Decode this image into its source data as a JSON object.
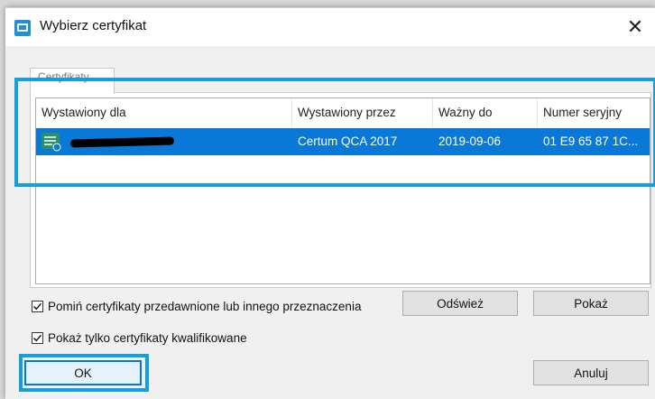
{
  "window": {
    "title": "Wybierz certyfikat",
    "close_label": "✕"
  },
  "tabs": [
    {
      "label": "Certyfikaty"
    }
  ],
  "table": {
    "columns": [
      "Wystawiony dla",
      "Wystawiony przez",
      "Ważny do",
      "Numer seryjny"
    ],
    "rows": [
      {
        "issued_to": "",
        "issued_by": "Certum QCA 2017",
        "valid_to": "2019-09-06",
        "serial": "01 E9 65 87 1C...",
        "selected": true
      }
    ]
  },
  "options": {
    "skip_expired_label": "Pomiń certyfikaty przedawnione lub innego przeznaczenia",
    "skip_expired_checked": true,
    "qualified_only_label": "Pokaż tylko certyfikaty kwalifikowane",
    "qualified_only_checked": true
  },
  "buttons": {
    "refresh": "Odśwież",
    "show": "Pokaż",
    "ok": "OK",
    "cancel": "Anuluj"
  },
  "colors": {
    "selection": "#0a78d7",
    "annotation": "#14a0e0",
    "app_icon": "#1e8fd8"
  }
}
